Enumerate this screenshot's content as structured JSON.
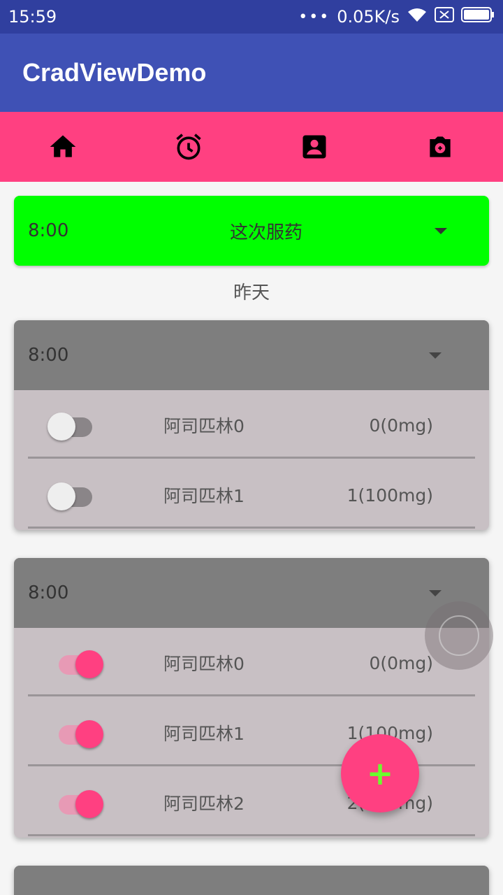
{
  "status_bar": {
    "time": "15:59",
    "dots": "•••",
    "net_speed": "0.05K/s",
    "icons": [
      "wifi-icon",
      "sim-x-icon",
      "battery-icon"
    ]
  },
  "app_bar": {
    "title": "CradViewDemo"
  },
  "tabs": [
    {
      "icon": "home-icon"
    },
    {
      "icon": "alarm-icon"
    },
    {
      "icon": "contact-icon"
    },
    {
      "icon": "camera-icon"
    }
  ],
  "current": {
    "time": "8:00",
    "title": "这次服药"
  },
  "day_label": "昨天",
  "cards": [
    {
      "time": "8:00",
      "rows": [
        {
          "name": "阿司匹林0",
          "dose": "0(0mg)",
          "on": false
        },
        {
          "name": "阿司匹林1",
          "dose": "1(100mg)",
          "on": false
        }
      ]
    },
    {
      "time": "8:00",
      "rows": [
        {
          "name": "阿司匹林0",
          "dose": "0(0mg)",
          "on": true
        },
        {
          "name": "阿司匹林1",
          "dose": "1(100mg)",
          "on": true
        },
        {
          "name": "阿司匹林2",
          "dose": "2(200mg)",
          "on": true
        }
      ]
    }
  ],
  "fab": {
    "label": "+"
  },
  "colors": {
    "primary": "#3f51b5",
    "primary_dark": "#303f9f",
    "accent": "#ff4081",
    "current_card": "#00ff00",
    "card_header": "#7e7e7e"
  }
}
